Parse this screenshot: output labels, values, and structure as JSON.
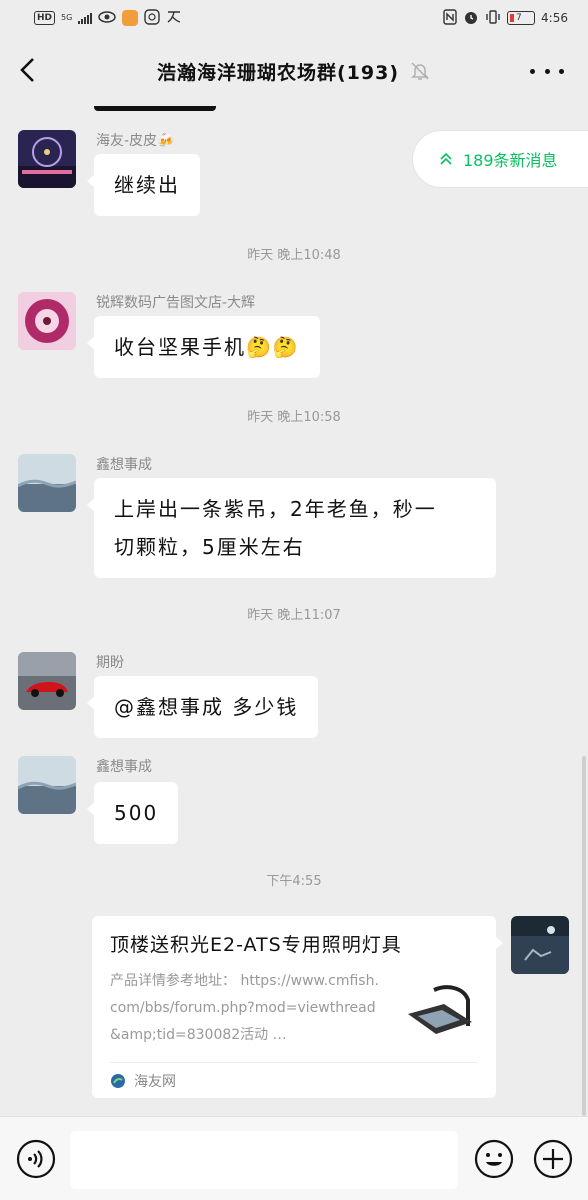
{
  "status_bar": {
    "left_badges": [
      "HD",
      "5G"
    ],
    "time": "4:56",
    "battery_level": "7"
  },
  "header": {
    "title": "浩瀚海洋珊瑚农场群(193)"
  },
  "new_messages_pill": {
    "label": "189条新消息"
  },
  "messages": [
    {
      "sender": "海友-皮皮🍻",
      "text": "继续出"
    },
    {
      "timestamp": "昨天 晚上10:48"
    },
    {
      "sender": "锐辉数码广告图文店-大辉",
      "text": "收台坚果手机🤔🤔"
    },
    {
      "timestamp": "昨天 晚上10:58"
    },
    {
      "sender": "鑫想事成",
      "text_line1": "上岸出一条紫吊，2年老鱼，秒一",
      "text_line2": "切颗粒，5厘米左右"
    },
    {
      "timestamp": "昨天 晚上11:07"
    },
    {
      "sender": "期盼",
      "text": "@鑫想事成  多少钱"
    },
    {
      "sender": "鑫想事成",
      "text": "500"
    },
    {
      "timestamp": "下午4:55"
    }
  ],
  "link_card": {
    "title": "顶楼送积光E2-ATS专用照明灯具",
    "description": "产品详情参考地址： https://www.cmfish.com/bbs/forum.php?mod=viewthread&amp;tid=830082活动 …",
    "source": "海友网"
  },
  "colors": {
    "background": "#ededed",
    "bubble": "#ffffff",
    "accent_green": "#07c160",
    "meta_text": "#999999"
  },
  "icons": [
    "back-chevron",
    "mute-bell",
    "more-dots",
    "double-up-chevron",
    "voice",
    "emoji",
    "plus"
  ]
}
